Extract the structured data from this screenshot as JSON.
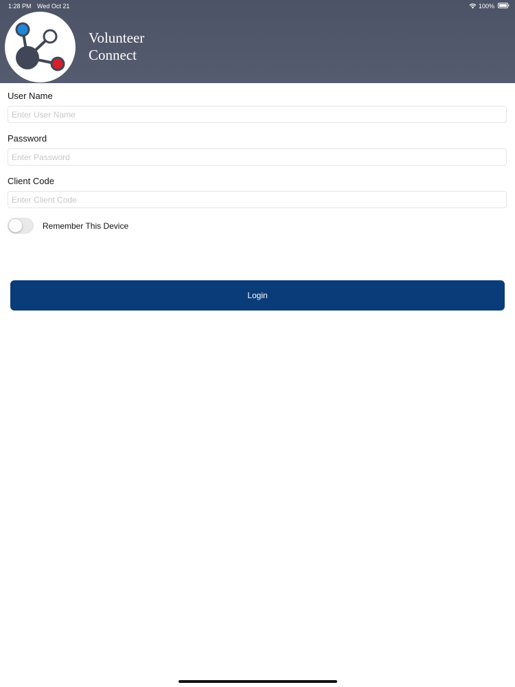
{
  "status_bar": {
    "time": "1:28 PM",
    "date": "Wed Oct 21",
    "battery": "100%",
    "wifi_icon": "wifi-icon",
    "battery_icon": "battery-icon"
  },
  "header": {
    "title_line1": "Volunteer",
    "title_line2": "Connect",
    "logo_icon": "network-logo-icon",
    "colors": {
      "background": "#51576b",
      "node_blue": "#1e88d8",
      "node_red": "#d81e2c",
      "node_dark": "#414757"
    }
  },
  "form": {
    "username": {
      "label": "User Name",
      "placeholder": "Enter User Name",
      "value": ""
    },
    "password": {
      "label": "Password",
      "placeholder": "Enter Password",
      "value": ""
    },
    "client_code": {
      "label": "Client Code",
      "placeholder": "Enter Client Code",
      "value": ""
    },
    "remember": {
      "label": "Remember This Device",
      "checked": false
    },
    "login_label": "Login",
    "accent_color": "#0b3c7a"
  }
}
